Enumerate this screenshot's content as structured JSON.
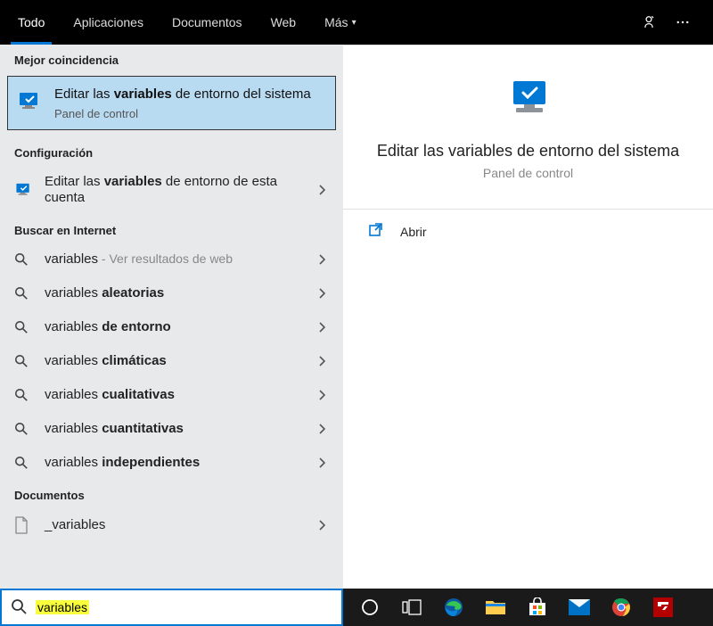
{
  "tabs": {
    "all": "Todo",
    "apps": "Aplicaciones",
    "docs": "Documentos",
    "web": "Web",
    "more": "Más"
  },
  "sections": {
    "best_match": "Mejor coincidencia",
    "settings": "Configuración",
    "search_web": "Buscar en Internet",
    "documents": "Documentos"
  },
  "best": {
    "title_pre": "Editar las ",
    "title_bold": "variables",
    "title_post": " de entorno del sistema",
    "subtitle": "Panel de control"
  },
  "settings_item": {
    "title_pre": "Editar las ",
    "title_bold": "variables",
    "title_post": " de entorno de esta cuenta"
  },
  "web_items": [
    {
      "pre": "variables",
      "bold": "",
      "post": "",
      "sub": " - Ver resultados de web"
    },
    {
      "pre": "variables ",
      "bold": "aleatorias",
      "post": "",
      "sub": ""
    },
    {
      "pre": "variables ",
      "bold": "de entorno",
      "post": "",
      "sub": ""
    },
    {
      "pre": "variables ",
      "bold": "climáticas",
      "post": "",
      "sub": ""
    },
    {
      "pre": "variables ",
      "bold": "cualitativas",
      "post": "",
      "sub": ""
    },
    {
      "pre": "variables ",
      "bold": "cuantitativas",
      "post": "",
      "sub": ""
    },
    {
      "pre": "variables ",
      "bold": "independientes",
      "post": "",
      "sub": ""
    }
  ],
  "doc_item": {
    "label": "_variables"
  },
  "preview": {
    "title": "Editar las variables de entorno del sistema",
    "subtitle": "Panel de control"
  },
  "action": {
    "open": "Abrir"
  },
  "search": {
    "value": "variables"
  },
  "colors": {
    "accent": "#0078d4",
    "highlight": "#faff3d"
  }
}
